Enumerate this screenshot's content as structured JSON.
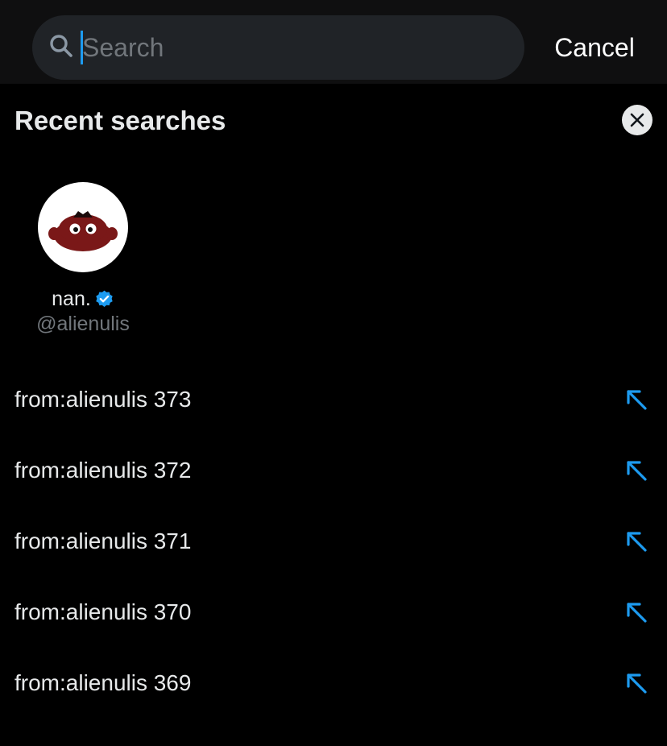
{
  "search": {
    "placeholder": "Search",
    "value": "",
    "cancel_label": "Cancel"
  },
  "recent": {
    "title": "Recent searches",
    "clear_icon": "close-icon",
    "users": [
      {
        "name": "nan.",
        "handle": "@alienulis",
        "verified": true,
        "avatar_icon": "red-alien-avatar"
      }
    ],
    "queries": [
      {
        "text": "from:alienulis 373",
        "action_icon": "arrow-up-left-icon"
      },
      {
        "text": "from:alienulis 372",
        "action_icon": "arrow-up-left-icon"
      },
      {
        "text": "from:alienulis 371",
        "action_icon": "arrow-up-left-icon"
      },
      {
        "text": "from:alienulis 370",
        "action_icon": "arrow-up-left-icon"
      },
      {
        "text": "from:alienulis 369",
        "action_icon": "arrow-up-left-icon"
      }
    ]
  },
  "colors": {
    "background": "#000000",
    "top_bar": "#0f0f10",
    "search_field": "#202327",
    "accent": "#1d9bf0",
    "primary_text": "#e7e9ea",
    "secondary_text": "#71767b",
    "avatar_character": "#7a1818"
  }
}
